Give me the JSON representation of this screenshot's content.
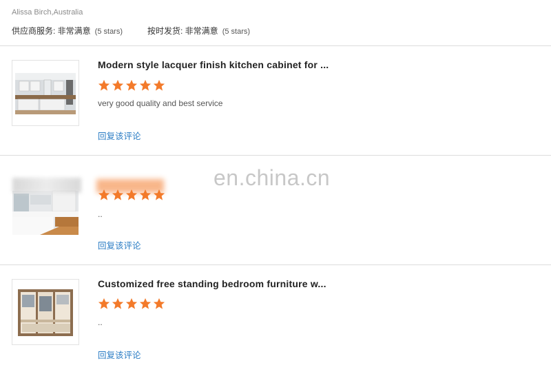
{
  "header": {
    "reviewer": "Alissa Birch,Australia",
    "supplier_label": "供应商服务: 非常满意",
    "supplier_stars": "(5 stars)",
    "delivery_label": "按时发货: 非常满意",
    "delivery_stars": "(5 stars)"
  },
  "reviews": [
    {
      "title": "Modern style lacquer finish kitchen cabinet for ...",
      "rating": 5,
      "comment": "very good quality and best service",
      "reply_label": "回复该评论",
      "image": "kitchen-cabinet-photo"
    },
    {
      "title": "",
      "rating": 5,
      "comment": "..",
      "reply_label": "回复该评论",
      "image": "kitchen-photo"
    },
    {
      "title": "Customized free standing bedroom furniture w...",
      "rating": 5,
      "comment": "..",
      "reply_label": "回复该评论",
      "image": "wardrobe-photo"
    }
  ],
  "watermark": "en.china.cn",
  "colors": {
    "star": "#f37a2a",
    "link": "#2a7cc4",
    "divider": "#dcdcdc"
  },
  "icons": [
    "star-icon"
  ]
}
